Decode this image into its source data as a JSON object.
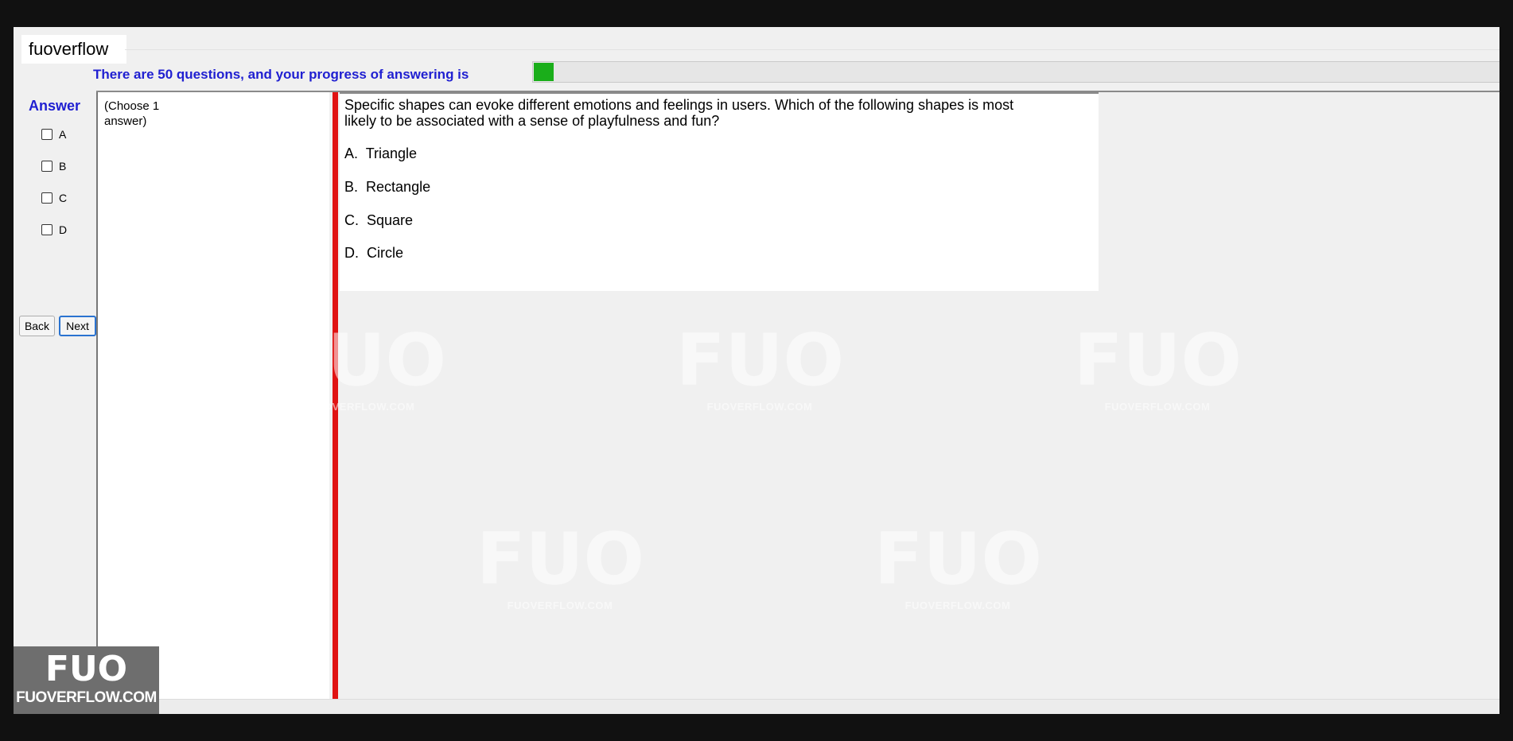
{
  "app": {
    "title": "fuoverflow"
  },
  "progress": {
    "label": "There are 50 questions, and your progress of answering is",
    "fraction": 0.02,
    "color": "#1aae1a"
  },
  "answer": {
    "title": "Answer",
    "options": [
      {
        "label": "A",
        "checked": false
      },
      {
        "label": "B",
        "checked": false
      },
      {
        "label": "C",
        "checked": false
      },
      {
        "label": "D",
        "checked": false
      }
    ]
  },
  "nav": {
    "back_label": "Back",
    "next_label": "Next"
  },
  "choose": {
    "text": "(Choose 1 answer)"
  },
  "question": {
    "text": "Specific shapes can evoke different emotions and feelings in users. Which of the following shapes is most likely to be associated with a sense of playfulness and fun?",
    "options": [
      {
        "letter": "A.",
        "text": "Triangle"
      },
      {
        "letter": "B.",
        "text": "Rectangle"
      },
      {
        "letter": "C.",
        "text": "Square"
      },
      {
        "letter": "D.",
        "text": "Circle"
      }
    ]
  },
  "watermark": {
    "mark": "FUO",
    "text": "FUOVERFLOW.COM"
  },
  "logo": {
    "mark": "FUO",
    "text": "FUOVERFLOW.COM"
  },
  "colors": {
    "accent": "#1f1fd1",
    "divider": "#e01313"
  }
}
